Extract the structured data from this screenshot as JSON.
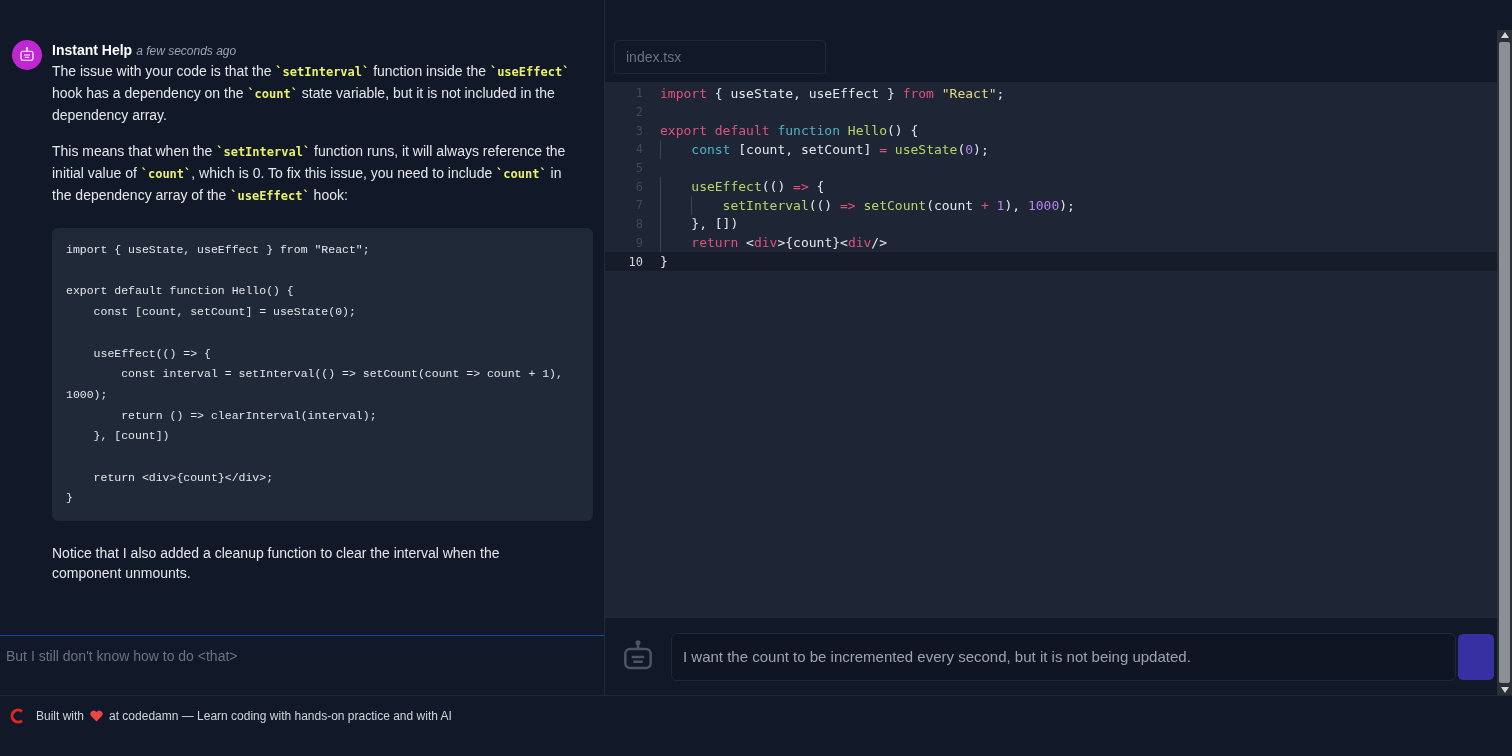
{
  "chat": {
    "message": {
      "author": "Instant Help",
      "time": "a few seconds ago",
      "paragraphs": [
        [
          {
            "kind": "text",
            "text": "The issue with your code is that the "
          },
          {
            "kind": "code",
            "text": "`setInterval`"
          },
          {
            "kind": "text",
            "text": " function inside the "
          },
          {
            "kind": "code",
            "text": "`useEffect`"
          },
          {
            "kind": "text",
            "text": " hook has a dependency on the "
          },
          {
            "kind": "code",
            "text": "`count`"
          },
          {
            "kind": "text",
            "text": " state variable, but it is not included in the dependency array."
          }
        ],
        [
          {
            "kind": "text",
            "text": "This means that when the "
          },
          {
            "kind": "code",
            "text": "`setInterval`"
          },
          {
            "kind": "text",
            "text": " function runs, it will always reference the initial value of "
          },
          {
            "kind": "code",
            "text": "`count`"
          },
          {
            "kind": "text",
            "text": ", which is 0. To fix this issue, you need to include "
          },
          {
            "kind": "code",
            "text": "`count`"
          },
          {
            "kind": "text",
            "text": " in the dependency array of the "
          },
          {
            "kind": "code",
            "text": "`useEffect`"
          },
          {
            "kind": "text",
            "text": " hook:"
          }
        ]
      ],
      "code_block": "import { useState, useEffect } from \"React\";\n\nexport default function Hello() {\n    const [count, setCount] = useState(0);\n\n    useEffect(() => {\n        const interval = setInterval(() => setCount(count => count + 1),\n1000);\n        return () => clearInterval(interval);\n    }, [count])\n\n    return <div>{count}</div>;\n}",
      "closing": "Notice that I also added a cleanup function to clear the interval when the component unmounts."
    },
    "input": {
      "placeholder": "But I still don't know how to do <that>"
    }
  },
  "editor": {
    "tab": {
      "label": "index.tsx"
    },
    "lines": [
      {
        "number": "1",
        "current": false,
        "tokens": [
          {
            "kind": "keyword",
            "text": "import"
          },
          {
            "kind": "plain",
            "text": " { useState, useEffect } "
          },
          {
            "kind": "keyword",
            "text": "from"
          },
          {
            "kind": "string",
            "text": " \"React\""
          },
          {
            "kind": "plain",
            "text": ";"
          }
        ]
      },
      {
        "number": "2",
        "current": false
      },
      {
        "number": "3",
        "current": false,
        "tokens": [
          {
            "kind": "keyword",
            "text": "export default"
          },
          {
            "kind": "type",
            "text": " function"
          },
          {
            "kind": "func",
            "text": " Hello"
          },
          {
            "kind": "plain",
            "text": "() {"
          }
        ]
      },
      {
        "number": "4",
        "current": false,
        "tokens": [
          {
            "kind": "type",
            "text": "    const"
          },
          {
            "kind": "plain",
            "text": " [count, setCount] "
          },
          {
            "kind": "op",
            "text": "="
          },
          {
            "kind": "func",
            "text": " useState"
          },
          {
            "kind": "plain",
            "text": "("
          },
          {
            "kind": "number",
            "text": "0"
          },
          {
            "kind": "plain",
            "text": ");"
          }
        ]
      },
      {
        "number": "5",
        "current": false
      },
      {
        "number": "6",
        "current": false,
        "tokens": [
          {
            "kind": "func",
            "text": "    useEffect"
          },
          {
            "kind": "plain",
            "text": "(() "
          },
          {
            "kind": "op",
            "text": "=>"
          },
          {
            "kind": "plain",
            "text": " {"
          }
        ]
      },
      {
        "number": "7",
        "current": false,
        "tokens": [
          {
            "kind": "func",
            "text": "        setInterval"
          },
          {
            "kind": "plain",
            "text": "(() "
          },
          {
            "kind": "op",
            "text": "=>"
          },
          {
            "kind": "func",
            "text": " setCount"
          },
          {
            "kind": "plain",
            "text": "(count "
          },
          {
            "kind": "op",
            "text": "+"
          },
          {
            "kind": "number",
            "text": " 1"
          },
          {
            "kind": "plain",
            "text": "), "
          },
          {
            "kind": "number",
            "text": "1000"
          },
          {
            "kind": "plain",
            "text": ");"
          }
        ]
      },
      {
        "number": "8",
        "current": false,
        "tokens": [
          {
            "kind": "plain",
            "text": "    }, [])"
          }
        ]
      },
      {
        "number": "9",
        "current": false,
        "tokens": [
          {
            "kind": "keyword",
            "text": "    return"
          },
          {
            "kind": "plain",
            "text": " <"
          },
          {
            "kind": "keyword",
            "text": "div"
          },
          {
            "kind": "plain",
            "text": ">{count}<"
          },
          {
            "kind": "keyword",
            "text": "div"
          },
          {
            "kind": "plain",
            "text": "/>"
          }
        ]
      },
      {
        "number": "10",
        "current": true,
        "tokens": [
          {
            "kind": "plain",
            "text": "}"
          }
        ]
      }
    ],
    "prompt": {
      "value": "I want the count to be incremented every second, but it is not being updated."
    }
  },
  "footer": {
    "before": "Built with",
    "after": "at codedamn — Learn coding with hands-on practice and with AI"
  }
}
